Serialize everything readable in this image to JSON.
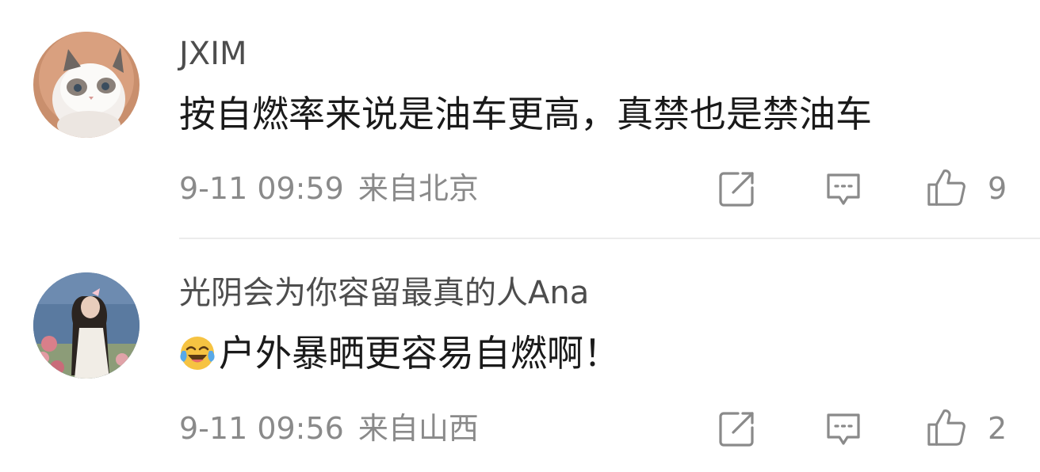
{
  "comments": [
    {
      "avatar_icon": "cat-avatar",
      "username": "JXIM",
      "emoji_icon": "",
      "text": "按自燃率来说是油车更高，真禁也是禁油车",
      "time": "9-11 09:59",
      "location": "来自北京",
      "likes": "9"
    },
    {
      "avatar_icon": "girl-avatar",
      "username": "光阴会为你容留最真的人Ana",
      "emoji_icon": "laughing-crying-emoji",
      "text": "户外暴晒更容易自燃啊！",
      "time": "9-11 09:56",
      "location": "来自山西",
      "likes": "2"
    }
  ],
  "icons": {
    "share": "share-icon",
    "reply": "comment-icon",
    "like": "thumbs-up-icon"
  },
  "colors": {
    "text_primary": "#1a1a1a",
    "text_secondary": "#8a8a8a",
    "username": "#4d4d4d",
    "divider": "#ececec"
  }
}
